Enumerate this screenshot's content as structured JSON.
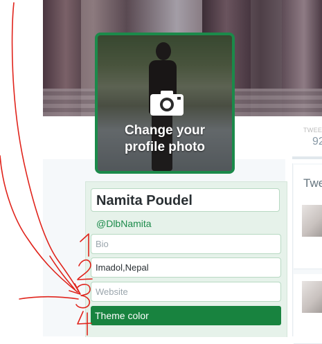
{
  "avatar": {
    "overlay_text": "Change your profile photo",
    "icon": "camera-icon"
  },
  "stats": {
    "tweets_label": "TWEE",
    "tweets_value": "92"
  },
  "timeline": {
    "title": "Twe"
  },
  "profile": {
    "name": "Namita Poudel",
    "handle": "@DlbNamita",
    "bio_placeholder": "Bio",
    "location_value": "Imadol,Nepal",
    "website_placeholder": "Website",
    "theme_color_label": "Theme color"
  },
  "colors": {
    "theme": "#18833f",
    "avatar_border": "#1b8a4a",
    "annotation": "#e0231b"
  }
}
